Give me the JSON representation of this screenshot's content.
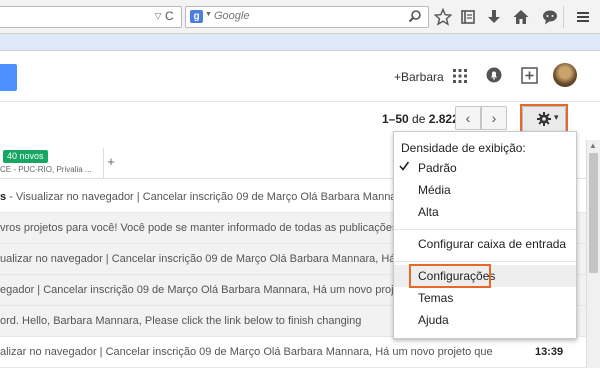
{
  "browser": {
    "search_engine_letter": "g",
    "search_placeholder": "Google",
    "url_dropdown_glyph": "▽",
    "reload_glyph": "C",
    "toolbar_icons": [
      "star-icon",
      "reading-list-icon",
      "download-icon",
      "home-icon",
      "chat-icon",
      "menu-icon"
    ]
  },
  "gmail": {
    "user_link": "+Barbara",
    "pager": {
      "range": "1–50",
      "of": "de",
      "total": "2.822"
    },
    "tabs": {
      "badge": "40 novos",
      "subtitle": "CE - PUC-RIO, Privalia ...",
      "add_glyph": "+"
    },
    "settings_caret": "▾",
    "emails": [
      {
        "text": "s - Visualizar no navegador | Cancelar inscrição 09 de Março Olá Barbara Mannara, Há",
        "time": "",
        "state": "unread",
        "bold_prefix": "s"
      },
      {
        "text": "vros projetos para você! Você pode se manter informado de todas as publicações de",
        "time": "",
        "state": "read"
      },
      {
        "text": "ualizar no navegador | Cancelar inscrição 09 de Março Olá Barbara Mannara, Há um novo",
        "time": "",
        "state": "read"
      },
      {
        "text": "egador | Cancelar inscrição 09 de Março Olá Barbara Mannara, Há um novo projeto que",
        "time": "",
        "state": "read"
      },
      {
        "text": "ord. Hello, Barbara Mannara, Please click the link below to finish changing",
        "time": "",
        "state": "read"
      },
      {
        "text": "alizar no navegador | Cancelar inscrição 09 de Março Olá Barbara Mannara, Há um novo projeto que",
        "time": "13:39",
        "state": "unread"
      }
    ]
  },
  "menu": {
    "heading": "Densidade de exibição:",
    "density_options": [
      "Padrão",
      "Média",
      "Alta"
    ],
    "selected": "Padrão",
    "configure_inbox": "Configurar caixa de entrada",
    "settings": "Configurações",
    "themes": "Temas",
    "help": "Ajuda"
  },
  "colors": {
    "highlight_orange": "#e8682c",
    "compose_blue": "#4d90fe",
    "badge_green": "#16a765"
  }
}
